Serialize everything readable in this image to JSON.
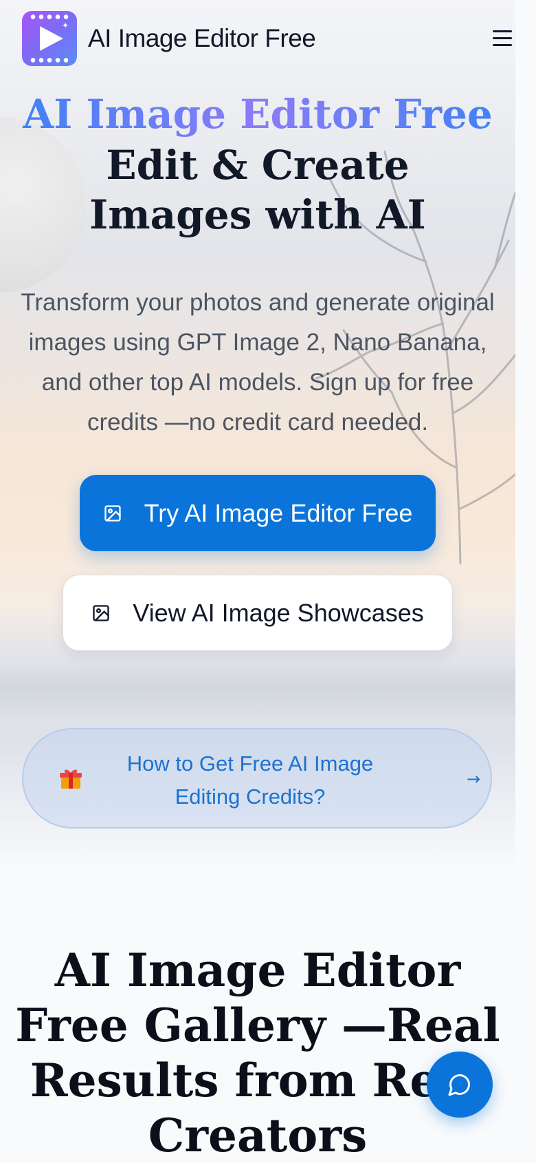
{
  "header": {
    "brand_name": "AI Image Editor Free",
    "logo_icon": "play-video-icon",
    "menu_icon": "hamburger-menu-icon"
  },
  "hero": {
    "title_highlight": "AI Image Editor Free",
    "title_line2": "Edit & Create",
    "title_line3": "Images with AI",
    "subtitle": "Transform your photos and generate original images using GPT Image 2, Nano Banana, and other top AI models. Sign up for free credits —no credit card needed.",
    "primary_button": "Try AI Image Editor Free",
    "secondary_button": "View AI Image Showcases",
    "button_icon": "image-icon"
  },
  "credits": {
    "icon": "gift-icon",
    "text": "How to Get Free AI Image Editing Credits?",
    "arrow_icon": "arrow-right-icon"
  },
  "gallery": {
    "title": "AI Image Editor Free Gallery —Real Results from Real Creators"
  },
  "chat": {
    "icon": "chat-bubble-icon"
  },
  "colors": {
    "accent": "#0a74da",
    "title_gradient_start": "#3b82f6",
    "title_gradient_mid": "#8b7cf6",
    "link_blue": "#1d72d0"
  }
}
